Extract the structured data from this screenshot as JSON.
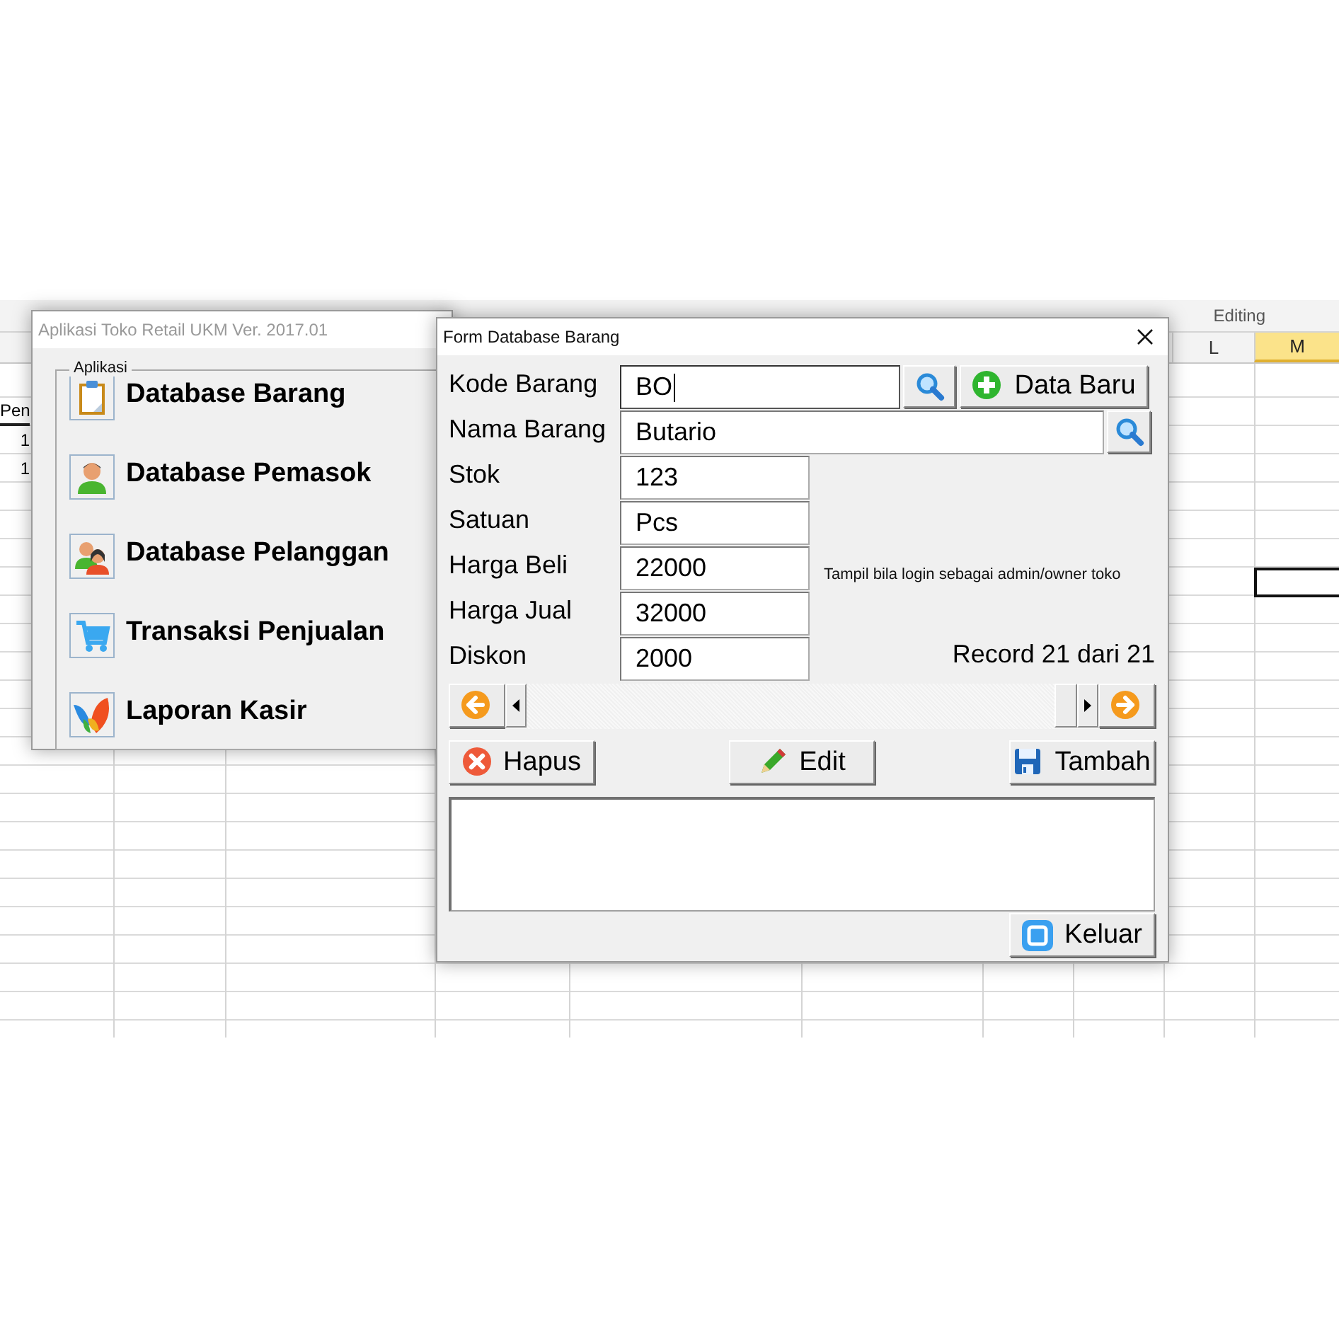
{
  "spreadsheet": {
    "ribbon_groups": [
      "Editing"
    ],
    "columns": [
      {
        "label": "L",
        "selected": false
      },
      {
        "label": "M",
        "selected": true
      }
    ],
    "cells": [
      "Pen",
      "1",
      "1"
    ]
  },
  "app_window": {
    "title": "Aplikasi Toko Retail UKM Ver. 2017.01",
    "group_label": "Aplikasi",
    "menu_items": [
      "Database Barang",
      "Database Pemasok",
      "Database Pelanggan",
      "Transaksi Penjualan",
      "Laporan Kasir"
    ]
  },
  "form_window": {
    "title": "Form Database Barang",
    "fields": [
      {
        "label": "Kode Barang",
        "value": "BO",
        "kind": "lookup-new",
        "focused": true,
        "button": "Data Baru"
      },
      {
        "label": "Nama Barang",
        "value": "Butario",
        "kind": "lookup",
        "focused": false
      },
      {
        "label": "Stok",
        "value": "123",
        "kind": "plain",
        "focused": false
      },
      {
        "label": "Satuan",
        "value": "Pcs",
        "kind": "plain",
        "focused": false
      },
      {
        "label": "Harga Beli",
        "value": "22000",
        "kind": "plain",
        "focused": false,
        "note": "Tampil bila login sebagai admin/owner toko"
      },
      {
        "label": "Harga Jual",
        "value": "32000",
        "kind": "plain",
        "focused": false
      },
      {
        "label": "Diskon",
        "value": "2000",
        "kind": "plain",
        "focused": false,
        "record": "Record 21 dari 21"
      }
    ],
    "actions": [
      "Hapus",
      "Edit",
      "Tambah"
    ],
    "close_button": "Keluar"
  }
}
